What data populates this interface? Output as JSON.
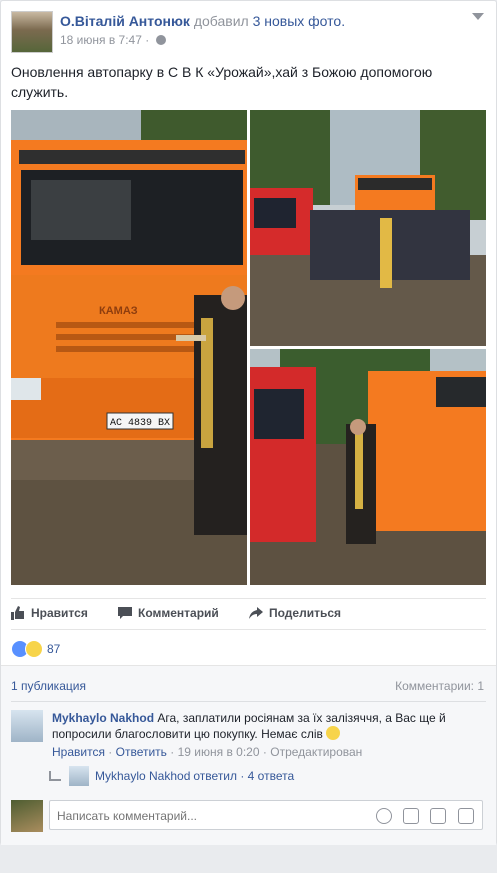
{
  "post": {
    "author": "О.Віталій Антонюк",
    "action_text": "добавил",
    "action_link": "3 новых фото.",
    "timestamp": "18 июня в 7:47 ·",
    "text": "Оновлення автопарку в С В К «Урожай»,хай з Божою допомогою служить."
  },
  "photos": {
    "truck_brand": "КАМАЗ",
    "plate": "AC 4839 BX"
  },
  "actions": {
    "like_label": "Нравится",
    "comment_label": "Комментарий",
    "share_label": "Поделиться"
  },
  "reactions": {
    "count": "87"
  },
  "stats": {
    "shares": "1 публикация",
    "comments": "Комментарии: 1"
  },
  "comment": {
    "author": "Mykhaylo Nakhod",
    "text": " Ага, заплатили росіянам за їх залізяччя, а Вас ще й попросили благословити цю покупку. Немає слів",
    "like": "Нравится",
    "reply": "Ответить",
    "time": "19 июня в 0:20",
    "edited": "Отредактирован",
    "sep": "·"
  },
  "reply_summary": {
    "author": "Mykhaylo Nakhod",
    "text": "ответил · 4 ответа"
  },
  "composer": {
    "placeholder": "Написать комментарий..."
  },
  "icons": [
    "globe-icon",
    "chevron-down-icon",
    "like-icon",
    "comment-icon",
    "share-icon",
    "emoji-icon",
    "camera-icon",
    "gif-icon",
    "sticker-icon"
  ],
  "colors": {
    "link": "#365899",
    "muted": "#90949c",
    "truck_orange": "#f47a20"
  }
}
